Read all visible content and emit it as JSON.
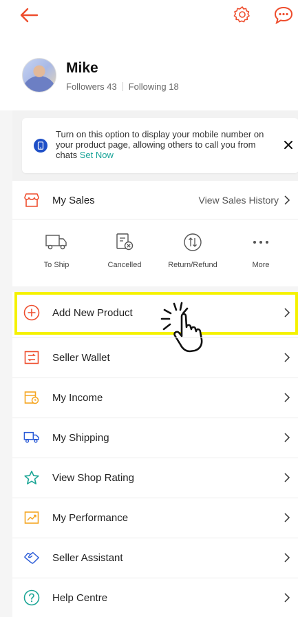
{
  "colors": {
    "accent": "#ee4d2d",
    "teal": "#17a397",
    "notice_blue": "#1e4fc7",
    "highlight": "#f5f200"
  },
  "header": {
    "back_icon": "arrow-left-icon",
    "settings_icon": "gear-icon",
    "chat_icon": "chat-bubble-icon"
  },
  "profile": {
    "name": "Mike",
    "followers": "Followers 43",
    "following": "Following 18"
  },
  "notice": {
    "text": "Turn on this option to display your mobile number on your product page, allowing others to call you from chats",
    "link": "Set Now",
    "icon": "phone-icon",
    "close_icon": "close-icon"
  },
  "sales": {
    "title": "My Sales",
    "history_link": "View Sales History",
    "statuses": [
      {
        "label": "To Ship",
        "icon": "truck-icon"
      },
      {
        "label": "Cancelled",
        "icon": "cancelled-doc-icon"
      },
      {
        "label": "Return/Refund",
        "icon": "return-refund-icon"
      },
      {
        "label": "More",
        "icon": "more-dots-icon"
      }
    ]
  },
  "menu": {
    "items": [
      {
        "label": "Add New Product",
        "icon": "add-circle-icon"
      },
      {
        "label": "Seller Wallet",
        "icon": "wallet-icon"
      },
      {
        "label": "My Income",
        "icon": "income-icon"
      },
      {
        "label": "My Shipping",
        "icon": "shipping-truck-icon"
      },
      {
        "label": "View Shop Rating",
        "icon": "star-icon"
      },
      {
        "label": "My Performance",
        "icon": "performance-chart-icon"
      },
      {
        "label": "Seller Assistant",
        "icon": "assistant-hand-icon"
      },
      {
        "label": "Help Centre",
        "icon": "help-icon"
      }
    ]
  }
}
